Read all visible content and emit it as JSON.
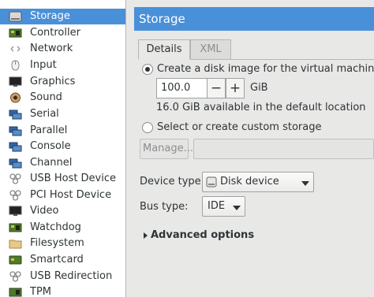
{
  "sidebar": {
    "items": [
      {
        "label": "Storage",
        "icon": "harddisk-icon",
        "selected": true
      },
      {
        "label": "Controller",
        "icon": "controller-icon"
      },
      {
        "label": "Network",
        "icon": "network-icon"
      },
      {
        "label": "Input",
        "icon": "keyboard-icon"
      },
      {
        "label": "Graphics",
        "icon": "monitor-icon"
      },
      {
        "label": "Sound",
        "icon": "speaker-icon"
      },
      {
        "label": "Serial",
        "icon": "serial-port-icon"
      },
      {
        "label": "Parallel",
        "icon": "parallel-port-icon"
      },
      {
        "label": "Console",
        "icon": "console-icon"
      },
      {
        "label": "Channel",
        "icon": "channel-icon"
      },
      {
        "label": "USB Host Device",
        "icon": "usb-icon"
      },
      {
        "label": "PCI Host Device",
        "icon": "pci-icon"
      },
      {
        "label": "Video",
        "icon": "video-icon"
      },
      {
        "label": "Watchdog",
        "icon": "watchdog-icon"
      },
      {
        "label": "Filesystem",
        "icon": "folder-icon"
      },
      {
        "label": "Smartcard",
        "icon": "smartcard-icon"
      },
      {
        "label": "USB Redirection",
        "icon": "usb-redirection-icon"
      },
      {
        "label": "TPM",
        "icon": "tpm-icon"
      }
    ]
  },
  "main": {
    "title": "Storage",
    "tabs": [
      {
        "label": "Details",
        "active": true
      },
      {
        "label": "XML",
        "active": false
      }
    ],
    "create_option": {
      "label": "Create a disk image for the virtual machine",
      "selected": true
    },
    "size": {
      "value": "100.0",
      "minus": "−",
      "plus": "+",
      "unit": "GiB"
    },
    "available_text": "16.0 GiB available in the default location",
    "custom_option": {
      "label": "Select or create custom storage",
      "selected": false
    },
    "manage_button": "Manage...",
    "device_type": {
      "label": "Device type:",
      "value": "Disk device",
      "icon": "disk-device-icon"
    },
    "bus_type": {
      "label": "Bus type:",
      "value": "IDE"
    },
    "advanced": "Advanced options"
  },
  "colors": {
    "accent": "#4a90d9",
    "background": "#e8e8e7",
    "sidebar_bg": "#ffffff",
    "text": "#2e3436"
  }
}
